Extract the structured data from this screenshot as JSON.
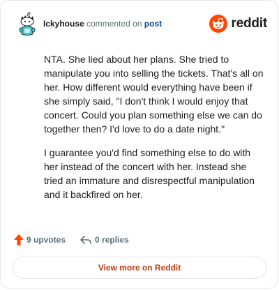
{
  "comment": {
    "username": "Ickyhouse",
    "action_text": "commented on",
    "post_link_label": "post",
    "paragraphs": [
      "NTA. She lied about her plans. She tried to manipulate you into selling the tickets. That's all on her. How different would everything have been if she simply said, \"I don't think I would enjoy that concert. Could you plan something else we can do together then? I'd love to do a date night.\"",
      "I guarantee you'd find something else to do with her instead of the concert with her. Instead she tried an immature and disrespectful manipulation and it backfired on her."
    ]
  },
  "brand": {
    "name": "reddit",
    "logo_icon": "reddit-snoo-icon",
    "accent_color": "#ff4500"
  },
  "stats": {
    "upvotes_label": "9 upvotes",
    "upvote_icon": "upvote-arrow-icon",
    "upvote_color": "#ff4500",
    "replies_label": "0 replies",
    "reply_icon": "reply-arrow-icon"
  },
  "footer": {
    "view_more_label": "View more on Reddit",
    "link_color": "#c3390d"
  }
}
